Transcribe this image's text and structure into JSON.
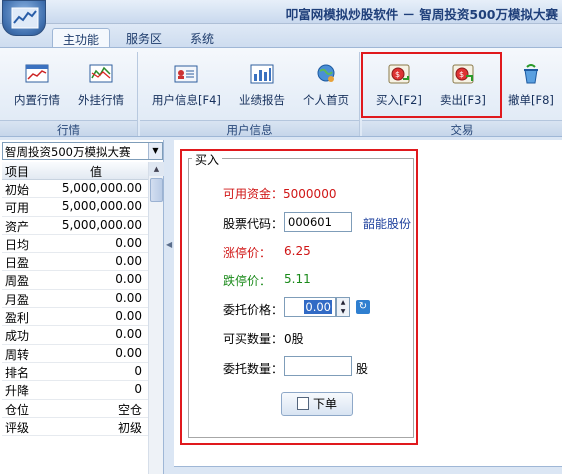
{
  "window": {
    "title": "叩富网模拟炒股软件 － 智周投资500万模拟大赛"
  },
  "tabs": [
    {
      "label": "主功能",
      "active": true
    },
    {
      "label": "服务区",
      "active": false
    },
    {
      "label": "系统",
      "active": false
    }
  ],
  "ribbon": {
    "groups": [
      {
        "label": "行情",
        "buttons": [
          {
            "label": "内置行情",
            "icon": "chart-icon"
          },
          {
            "label": "外挂行情",
            "icon": "trend-chart-icon"
          }
        ]
      },
      {
        "label": "用户信息",
        "buttons": [
          {
            "label": "用户信息[F4]",
            "icon": "id-card-icon"
          },
          {
            "label": "业绩报告",
            "icon": "bar-report-icon"
          },
          {
            "label": "个人首页",
            "icon": "globe-person-icon"
          }
        ]
      },
      {
        "label": "交易",
        "buttons": [
          {
            "label": "买入[F2]",
            "icon": "buy-icon"
          },
          {
            "label": "卖出[F3]",
            "icon": "sell-icon"
          },
          {
            "label": "撤单[F8]",
            "icon": "recycle-icon"
          }
        ]
      }
    ]
  },
  "left": {
    "contest_select": "智周投资500万模拟大赛",
    "grid_headers": [
      "项目",
      "值"
    ],
    "rows": [
      {
        "label": "初始",
        "value": "5,000,000.00"
      },
      {
        "label": "可用",
        "value": "5,000,000.00"
      },
      {
        "label": "资产",
        "value": "5,000,000.00"
      },
      {
        "label": "日均",
        "value": "0.00"
      },
      {
        "label": "日盈",
        "value": "0.00"
      },
      {
        "label": "周盈",
        "value": "0.00"
      },
      {
        "label": "月盈",
        "value": "0.00"
      },
      {
        "label": "盈利",
        "value": "0.00"
      },
      {
        "label": "成功",
        "value": "0.00"
      },
      {
        "label": "周转",
        "value": "0.00"
      },
      {
        "label": "排名",
        "value": "0"
      },
      {
        "label": "升降",
        "value": "0"
      },
      {
        "label": "仓位",
        "value": "空仓"
      },
      {
        "label": "评级",
        "value": "初级"
      }
    ]
  },
  "buy": {
    "legend": "买入",
    "available_funds_label": "可用资金：",
    "available_funds_value": "5000000",
    "stock_code_label": "股票代码：",
    "stock_code_value": "000601",
    "stock_name": "韶能股份",
    "limit_up_label": "涨停价：",
    "limit_up_value": "6.25",
    "limit_down_label": "跌停价：",
    "limit_down_value": "5.11",
    "price_label": "委托价格：",
    "price_value": "0.00",
    "buyable_label": "可买数量：",
    "buyable_value": "0股",
    "qty_label": "委托数量：",
    "qty_value": "",
    "qty_unit": "股",
    "submit_label": "下单"
  },
  "colors": {
    "highlight": "#e0191d",
    "red_text": "#d01616",
    "green_text": "#1a8a1a"
  }
}
